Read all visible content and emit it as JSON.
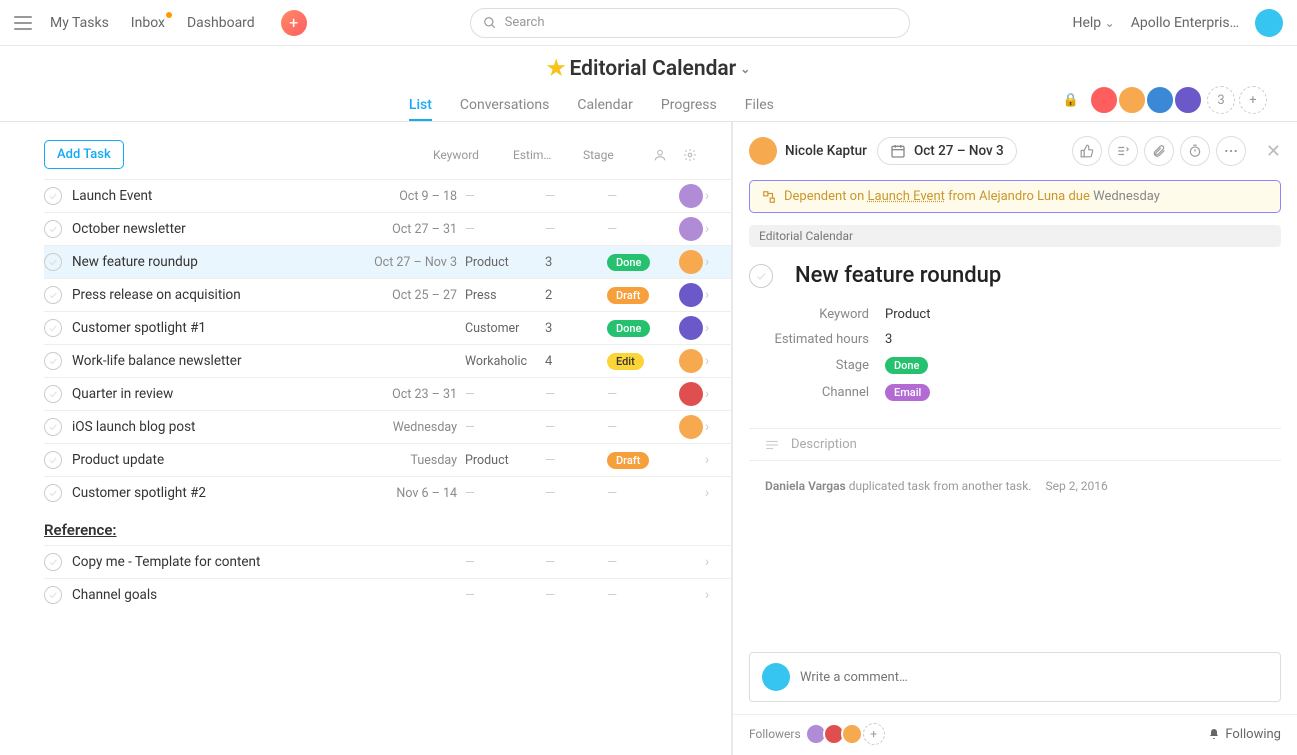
{
  "topnav": {
    "my_tasks": "My Tasks",
    "inbox": "Inbox",
    "dashboard": "Dashboard",
    "search_placeholder": "Search",
    "help": "Help",
    "org": "Apollo Enterpris…"
  },
  "project": {
    "title": "Editorial Calendar",
    "tabs": [
      "List",
      "Conversations",
      "Calendar",
      "Progress",
      "Files"
    ],
    "active_tab": "List",
    "member_count": "3"
  },
  "list": {
    "add_task": "Add Task",
    "cols": {
      "keyword": "Keyword",
      "estim": "Estim…",
      "stage": "Stage"
    },
    "tasks": [
      {
        "name": "Launch Event",
        "date": "Oct 9 – 18",
        "keyword": "",
        "est": "",
        "stage": "",
        "av": "#b08bd6"
      },
      {
        "name": "October newsletter",
        "date": "Oct 27 – 31",
        "keyword": "",
        "est": "",
        "stage": "",
        "av": "#b08bd6"
      },
      {
        "name": "New feature roundup",
        "date": "Oct 27 – Nov 3",
        "keyword": "Product",
        "est": "3",
        "stage": "Done",
        "av": "#f6a94e",
        "sel": true
      },
      {
        "name": "Press release on acquisition",
        "date": "Oct 25 – 27",
        "keyword": "Press",
        "est": "2",
        "stage": "Draft",
        "av": "#6b59c9"
      },
      {
        "name": "Customer spotlight #1",
        "date": "",
        "keyword": "Customer",
        "est": "3",
        "stage": "Done",
        "av": "#6b59c9"
      },
      {
        "name": "Work-life balance newsletter",
        "date": "",
        "keyword": "Workaholic",
        "est": "4",
        "stage": "Edit",
        "av": "#f6a94e"
      },
      {
        "name": "Quarter in review",
        "date": "Oct 23 – 31",
        "keyword": "",
        "est": "",
        "stage": "",
        "av": "#e04f4f"
      },
      {
        "name": "iOS launch blog post",
        "date": "Wednesday",
        "keyword": "",
        "est": "",
        "stage": "",
        "av": "#f6a94e"
      },
      {
        "name": "Product update",
        "date": "Tuesday",
        "keyword": "Product",
        "est": "",
        "stage": "Draft",
        "av": ""
      },
      {
        "name": "Customer spotlight #2",
        "date": "Nov 6 – 14",
        "keyword": "",
        "est": "",
        "stage": "",
        "av": ""
      }
    ],
    "section": "Reference:",
    "ref_tasks": [
      {
        "name": "Copy me - Template for content"
      },
      {
        "name": "Channel goals"
      }
    ]
  },
  "detail": {
    "assignee": "Nicole Kaptur",
    "date_range": "Oct 27 – Nov 3",
    "dep_prefix": "Dependent on",
    "dep_task": "Launch Event",
    "dep_mid": "from Alejandro Luna due",
    "dep_day": "Wednesday",
    "project_chip": "Editorial Calendar",
    "title": "New feature roundup",
    "fields": {
      "keyword_l": "Keyword",
      "keyword_v": "Product",
      "est_l": "Estimated hours",
      "est_v": "3",
      "stage_l": "Stage",
      "stage_v": "Done",
      "channel_l": "Channel",
      "channel_v": "Email"
    },
    "description_placeholder": "Description",
    "activity_who": "Daniela Vargas",
    "activity_what": "duplicated task from another task.",
    "activity_when": "Sep 2, 2016",
    "comment_placeholder": "Write a comment…",
    "followers_label": "Followers",
    "following": "Following"
  },
  "avatars": {
    "topright": "#36c5f0",
    "team": [
      "#ff5e5e",
      "#f6a94e",
      "#3a88d6",
      "#6b59c9"
    ],
    "detail_assignee": "#f6a94e",
    "commenter": "#36c5f0",
    "followers": [
      "#b08bd6",
      "#e04f4f",
      "#f6a94e"
    ]
  }
}
